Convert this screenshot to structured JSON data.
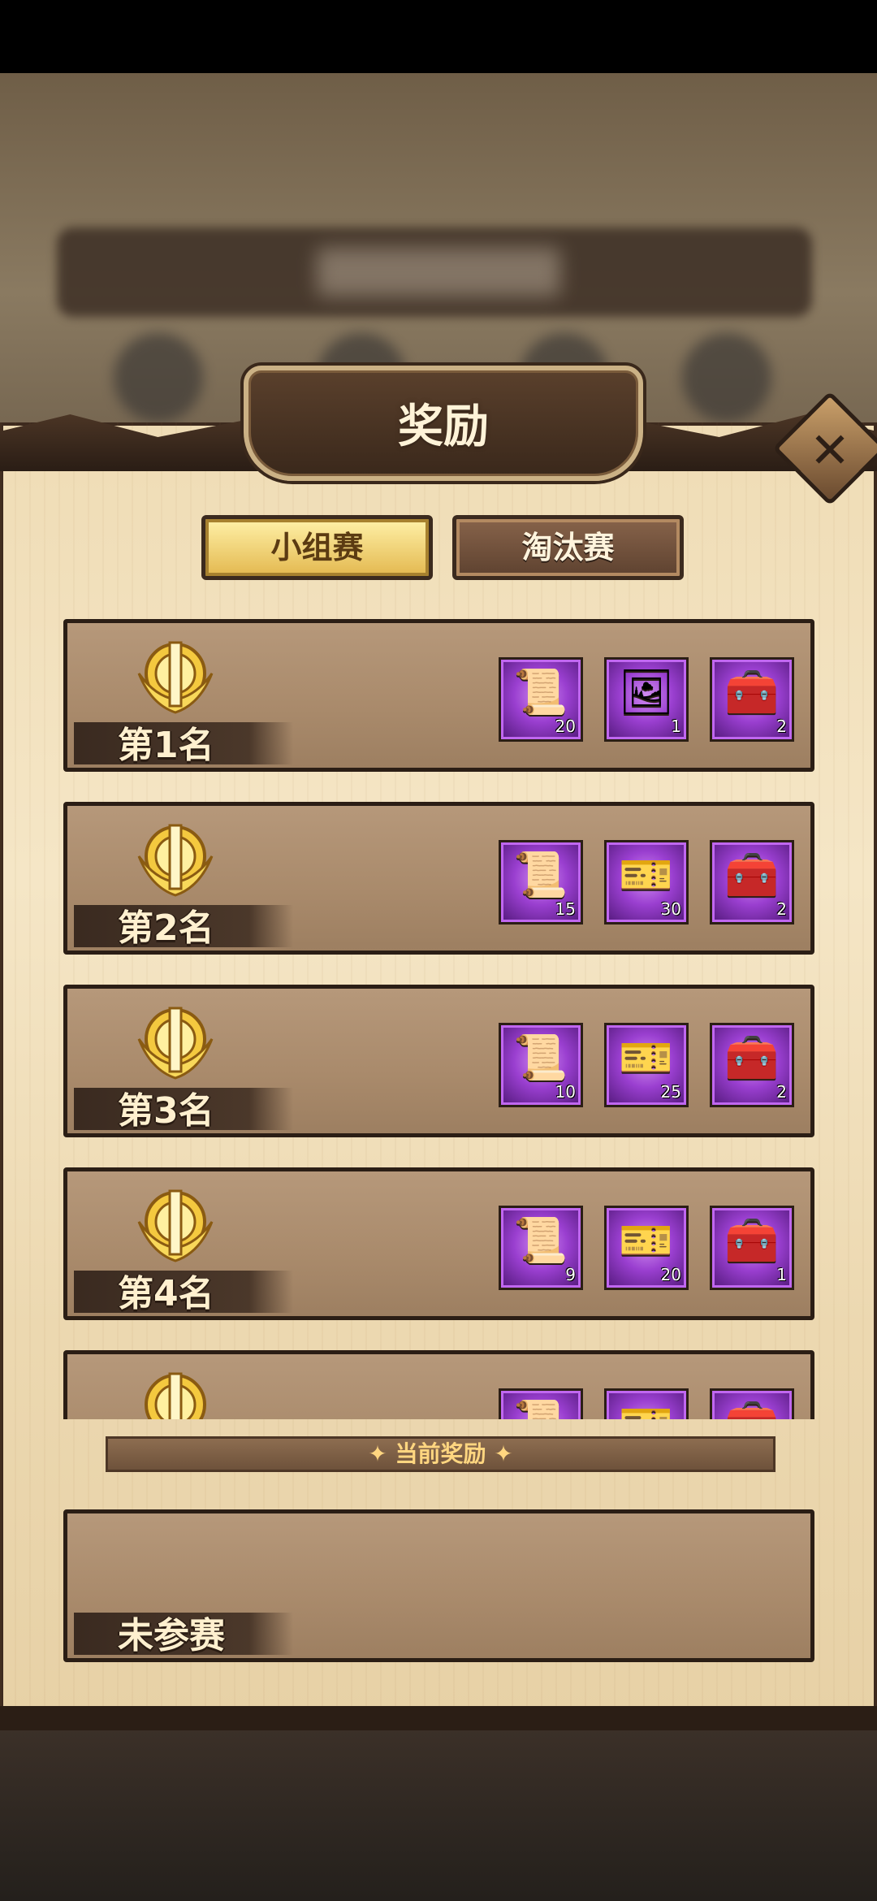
{
  "modal": {
    "title": "奖励",
    "close_icon": "close-icon"
  },
  "tabs": [
    {
      "label": "小组赛",
      "active": true
    },
    {
      "label": "淘汰赛",
      "active": false
    }
  ],
  "ranks": [
    {
      "label": "第1名",
      "rewards": [
        {
          "icon": "scroll-icon",
          "count": "20"
        },
        {
          "icon": "frame-icon",
          "count": "1"
        },
        {
          "icon": "chest-icon",
          "count": "2"
        }
      ]
    },
    {
      "label": "第2名",
      "rewards": [
        {
          "icon": "scroll-icon",
          "count": "15"
        },
        {
          "icon": "stamp-icon",
          "count": "30"
        },
        {
          "icon": "chest-icon",
          "count": "2"
        }
      ]
    },
    {
      "label": "第3名",
      "rewards": [
        {
          "icon": "scroll-icon",
          "count": "10"
        },
        {
          "icon": "stamp-icon",
          "count": "25"
        },
        {
          "icon": "chest-icon",
          "count": "2"
        }
      ]
    },
    {
      "label": "第4名",
      "rewards": [
        {
          "icon": "scroll-icon",
          "count": "9"
        },
        {
          "icon": "stamp-icon",
          "count": "20"
        },
        {
          "icon": "chest-icon",
          "count": "1"
        }
      ]
    }
  ],
  "current_reward": {
    "banner": "当前奖励",
    "status": "未参赛"
  },
  "colors": {
    "accent": "#e3b84f",
    "item_bg": "#9a3fd0",
    "panel": "#f5e6c6"
  }
}
